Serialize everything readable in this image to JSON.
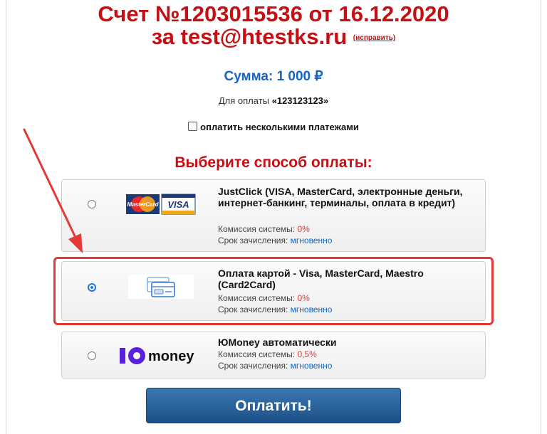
{
  "header": {
    "title_line1": "Счет №1203015536 от 16.12.2020",
    "title_line2": "за test@htestks.ru",
    "edit_link": "(исправить)"
  },
  "summary": {
    "sum": "Сумма: 1 000 ₽",
    "purpose_prefix": "Для оплаты ",
    "purpose_value": "«123123123»",
    "multi_payment_label": "оплатить несколькими платежами"
  },
  "choose_title": "Выберите способ оплаты:",
  "options": [
    {
      "title": "JustClick (VISA, MasterCard, электронные деньги, интернет-банкинг, терминалы, оплата в кредит)",
      "commission_label": "Комиссия системы: ",
      "commission_value": "0%",
      "term_label": "Срок зачисления: ",
      "term_value": "мгновенно",
      "selected": false,
      "logo_mastercard": "MasterCard",
      "logo_visa": "VISA"
    },
    {
      "title": "Оплата картой - Visa, MasterCard, Maestro (Card2Card)",
      "commission_label": "Комиссия системы: ",
      "commission_value": "0%",
      "term_label": "Срок зачисления: ",
      "term_value": "мгновенно",
      "selected": true
    },
    {
      "title": "ЮMoney автоматически",
      "commission_label": "Комиссия системы: ",
      "commission_value": "0,5%",
      "term_label": "Срок зачисления: ",
      "term_value": "мгновенно",
      "selected": false,
      "logo_text": "money"
    }
  ],
  "pay_button": "Оплатить!",
  "colors": {
    "title_red": "#c60f13",
    "sum_blue": "#1565c0",
    "highlight_red": "#e53935",
    "button_blue": "#2a6199"
  },
  "icons": [
    "mastercard-visa-logo",
    "card-icon",
    "yumoney-logo",
    "annotation-arrow"
  ]
}
